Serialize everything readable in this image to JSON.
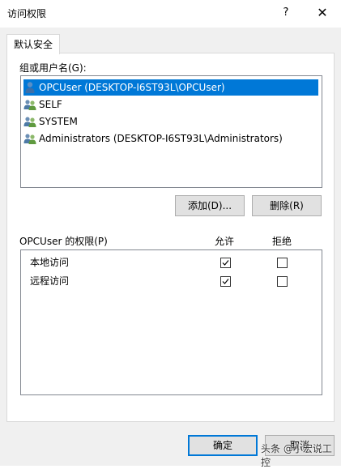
{
  "window": {
    "title": "访问权限",
    "help": "?",
    "close": "✕"
  },
  "tab": {
    "label": "默认安全"
  },
  "group_label": "组或用户名(G):",
  "users": [
    {
      "label": "OPCUser (DESKTOP-I6ST93L\\OPCUser)",
      "icon": "single-user-icon",
      "selected": true
    },
    {
      "label": "SELF",
      "icon": "group-users-icon",
      "selected": false
    },
    {
      "label": "SYSTEM",
      "icon": "group-users-icon",
      "selected": false
    },
    {
      "label": "Administrators (DESKTOP-I6ST93L\\Administrators)",
      "icon": "group-users-icon",
      "selected": false
    }
  ],
  "buttons": {
    "add": "添加(D)...",
    "remove": "删除(R)",
    "ok": "确定",
    "cancel": "取消"
  },
  "permissions": {
    "header": "OPCUser 的权限(P)",
    "allow_col": "允许",
    "deny_col": "拒绝",
    "rows": [
      {
        "label": "本地访问",
        "allow": true,
        "deny": false
      },
      {
        "label": "远程访问",
        "allow": true,
        "deny": false
      }
    ]
  },
  "watermark": "头条 @小宏说工控",
  "colors": {
    "selection": "#0078d7",
    "dialog_bg": "#f0f0f0",
    "button_bg": "#e1e1e1"
  }
}
